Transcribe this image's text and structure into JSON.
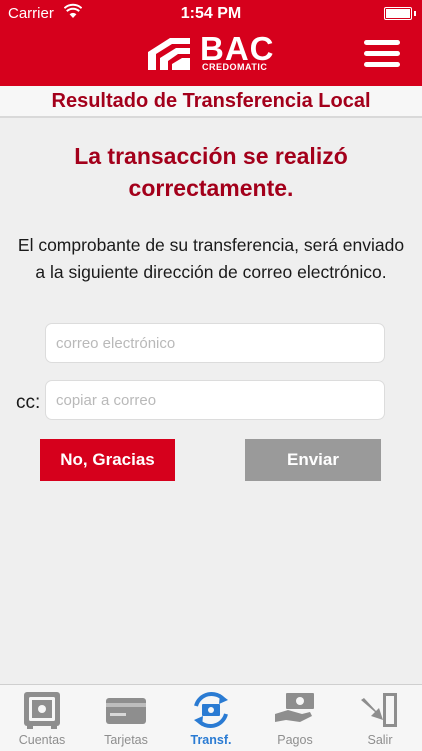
{
  "status_bar": {
    "carrier": "Carrier",
    "time": "1:54 PM"
  },
  "header": {
    "brand": "BAC",
    "brand_sub": "CREDOMATIC"
  },
  "page": {
    "title": "Resultado de Transferencia Local"
  },
  "message": {
    "headline": "La transacción se realizó correctamente.",
    "body": "El comprobante de su transferencia, será enviado a la siguiente dirección de correo electrónico."
  },
  "form": {
    "email_placeholder": "correo electrónico",
    "email_value": "",
    "cc_label": "cc:",
    "cc_placeholder": "copiar a correo",
    "cc_value": ""
  },
  "buttons": {
    "no_thanks": "No, Gracias",
    "send": "Enviar"
  },
  "tabs": [
    {
      "label": "Cuentas",
      "icon": "safe-icon",
      "active": false
    },
    {
      "label": "Tarjetas",
      "icon": "card-icon",
      "active": false
    },
    {
      "label": "Transf.",
      "icon": "transfer-icon",
      "active": true
    },
    {
      "label": "Pagos",
      "icon": "payment-icon",
      "active": false
    },
    {
      "label": "Salir",
      "icon": "exit-icon",
      "active": false
    }
  ],
  "colors": {
    "brand_red": "#d6001c",
    "title_red": "#a3001b",
    "active_tab": "#2a7bd3",
    "send_gray": "#9a9a9a"
  }
}
